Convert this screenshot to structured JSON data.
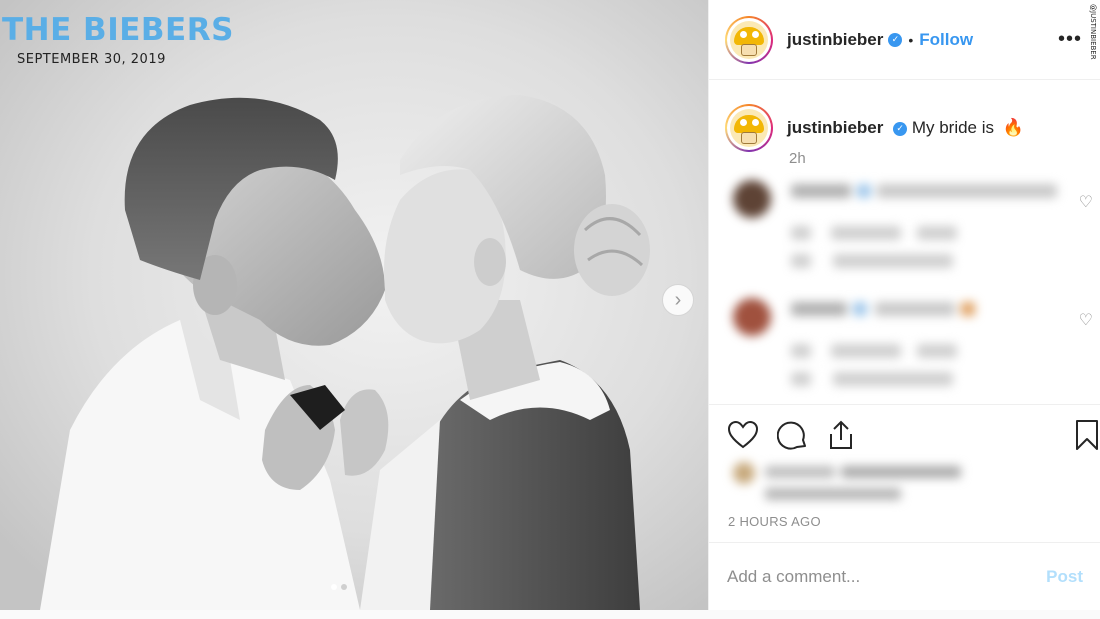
{
  "photo": {
    "title": "THE BIEBERS",
    "date": "SEPTEMBER 30, 2019",
    "next_icon": "chevron-right-icon",
    "carousel_dots": 2
  },
  "watermark": "@JUSTINBIEBER",
  "header": {
    "username": "justinbieber",
    "verified": true,
    "separator": "•",
    "follow_label": "Follow",
    "more_label": "•••"
  },
  "caption": {
    "username": "justinbieber",
    "text": "My bride is",
    "emoji": "🔥",
    "time": "2h"
  },
  "actions": {
    "icons": [
      "heart-icon",
      "comment-icon",
      "share-icon",
      "bookmark-icon"
    ]
  },
  "posted_ago": "2 HOURS AGO",
  "comment_box": {
    "placeholder": "Add a comment...",
    "post_label": "Post"
  },
  "colors": {
    "accent": "#3897f0",
    "title_blue": "#5aaee6",
    "post_disabled": "#b2dffc",
    "muted": "#8e8e8e"
  }
}
